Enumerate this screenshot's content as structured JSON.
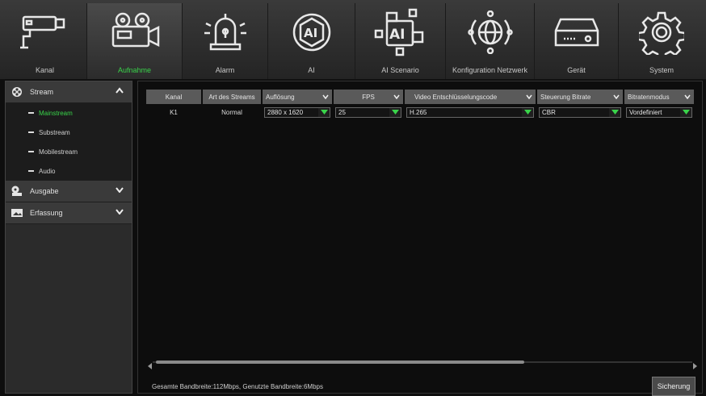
{
  "tabs": [
    {
      "label": "Kanal",
      "icon": "camera-icon"
    },
    {
      "label": "Aufnahme",
      "icon": "video-camera-icon",
      "active": true
    },
    {
      "label": "Alarm",
      "icon": "alarm-siren-icon"
    },
    {
      "label": "AI",
      "icon": "ai-icon"
    },
    {
      "label": "AI Scenario",
      "icon": "ai-scenario-icon"
    },
    {
      "label": "Konfiguration Netzwerk",
      "icon": "network-globe-icon"
    },
    {
      "label": "Gerät",
      "icon": "hard-drive-icon"
    },
    {
      "label": "System",
      "icon": "gear-icon"
    }
  ],
  "sidebar": {
    "stream": {
      "label": "Stream",
      "items": [
        {
          "label": "Mainstream"
        },
        {
          "label": "Substream"
        },
        {
          "label": "Mobilestream"
        },
        {
          "label": "Audio"
        }
      ]
    },
    "ausgabe": {
      "label": "Ausgabe"
    },
    "erfassung": {
      "label": "Erfassung"
    }
  },
  "table": {
    "headers": {
      "kanal": "Kanal",
      "art": "Art des Streams",
      "aufloesung": "Auflösung",
      "fps": "FPS",
      "codec": "Video Entschlüsselungscode",
      "bitrate_ctrl": "Steuerung Bitrate",
      "bitrate_mode": "Bitratenmodus"
    },
    "row": {
      "kanal": "K1",
      "art": "Normal",
      "aufloesung": "2880 x 1620",
      "fps": "25",
      "codec": "H.265",
      "bitrate_ctrl": "CBR",
      "bitrate_mode": "Vordefiniert"
    }
  },
  "status": "Gesamte Bandbreite:112Mbps, Genutzte Bandbreite:6Mbps",
  "save_label": "Sicherung",
  "colors": {
    "accent": "#39d34a",
    "header_bg": "#5a5a5a",
    "sidebar_bg": "#2b2b2b"
  }
}
